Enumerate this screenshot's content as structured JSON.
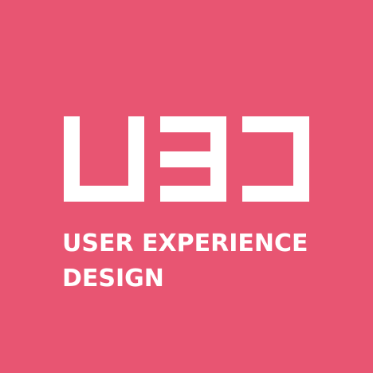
{
  "brand": {
    "logo_icon": "ued-logo-mark",
    "line1": "USER EXPERIENCE",
    "line2": "DESIGN"
  },
  "colors": {
    "background": "#E85572",
    "foreground": "#FFFFFF"
  }
}
